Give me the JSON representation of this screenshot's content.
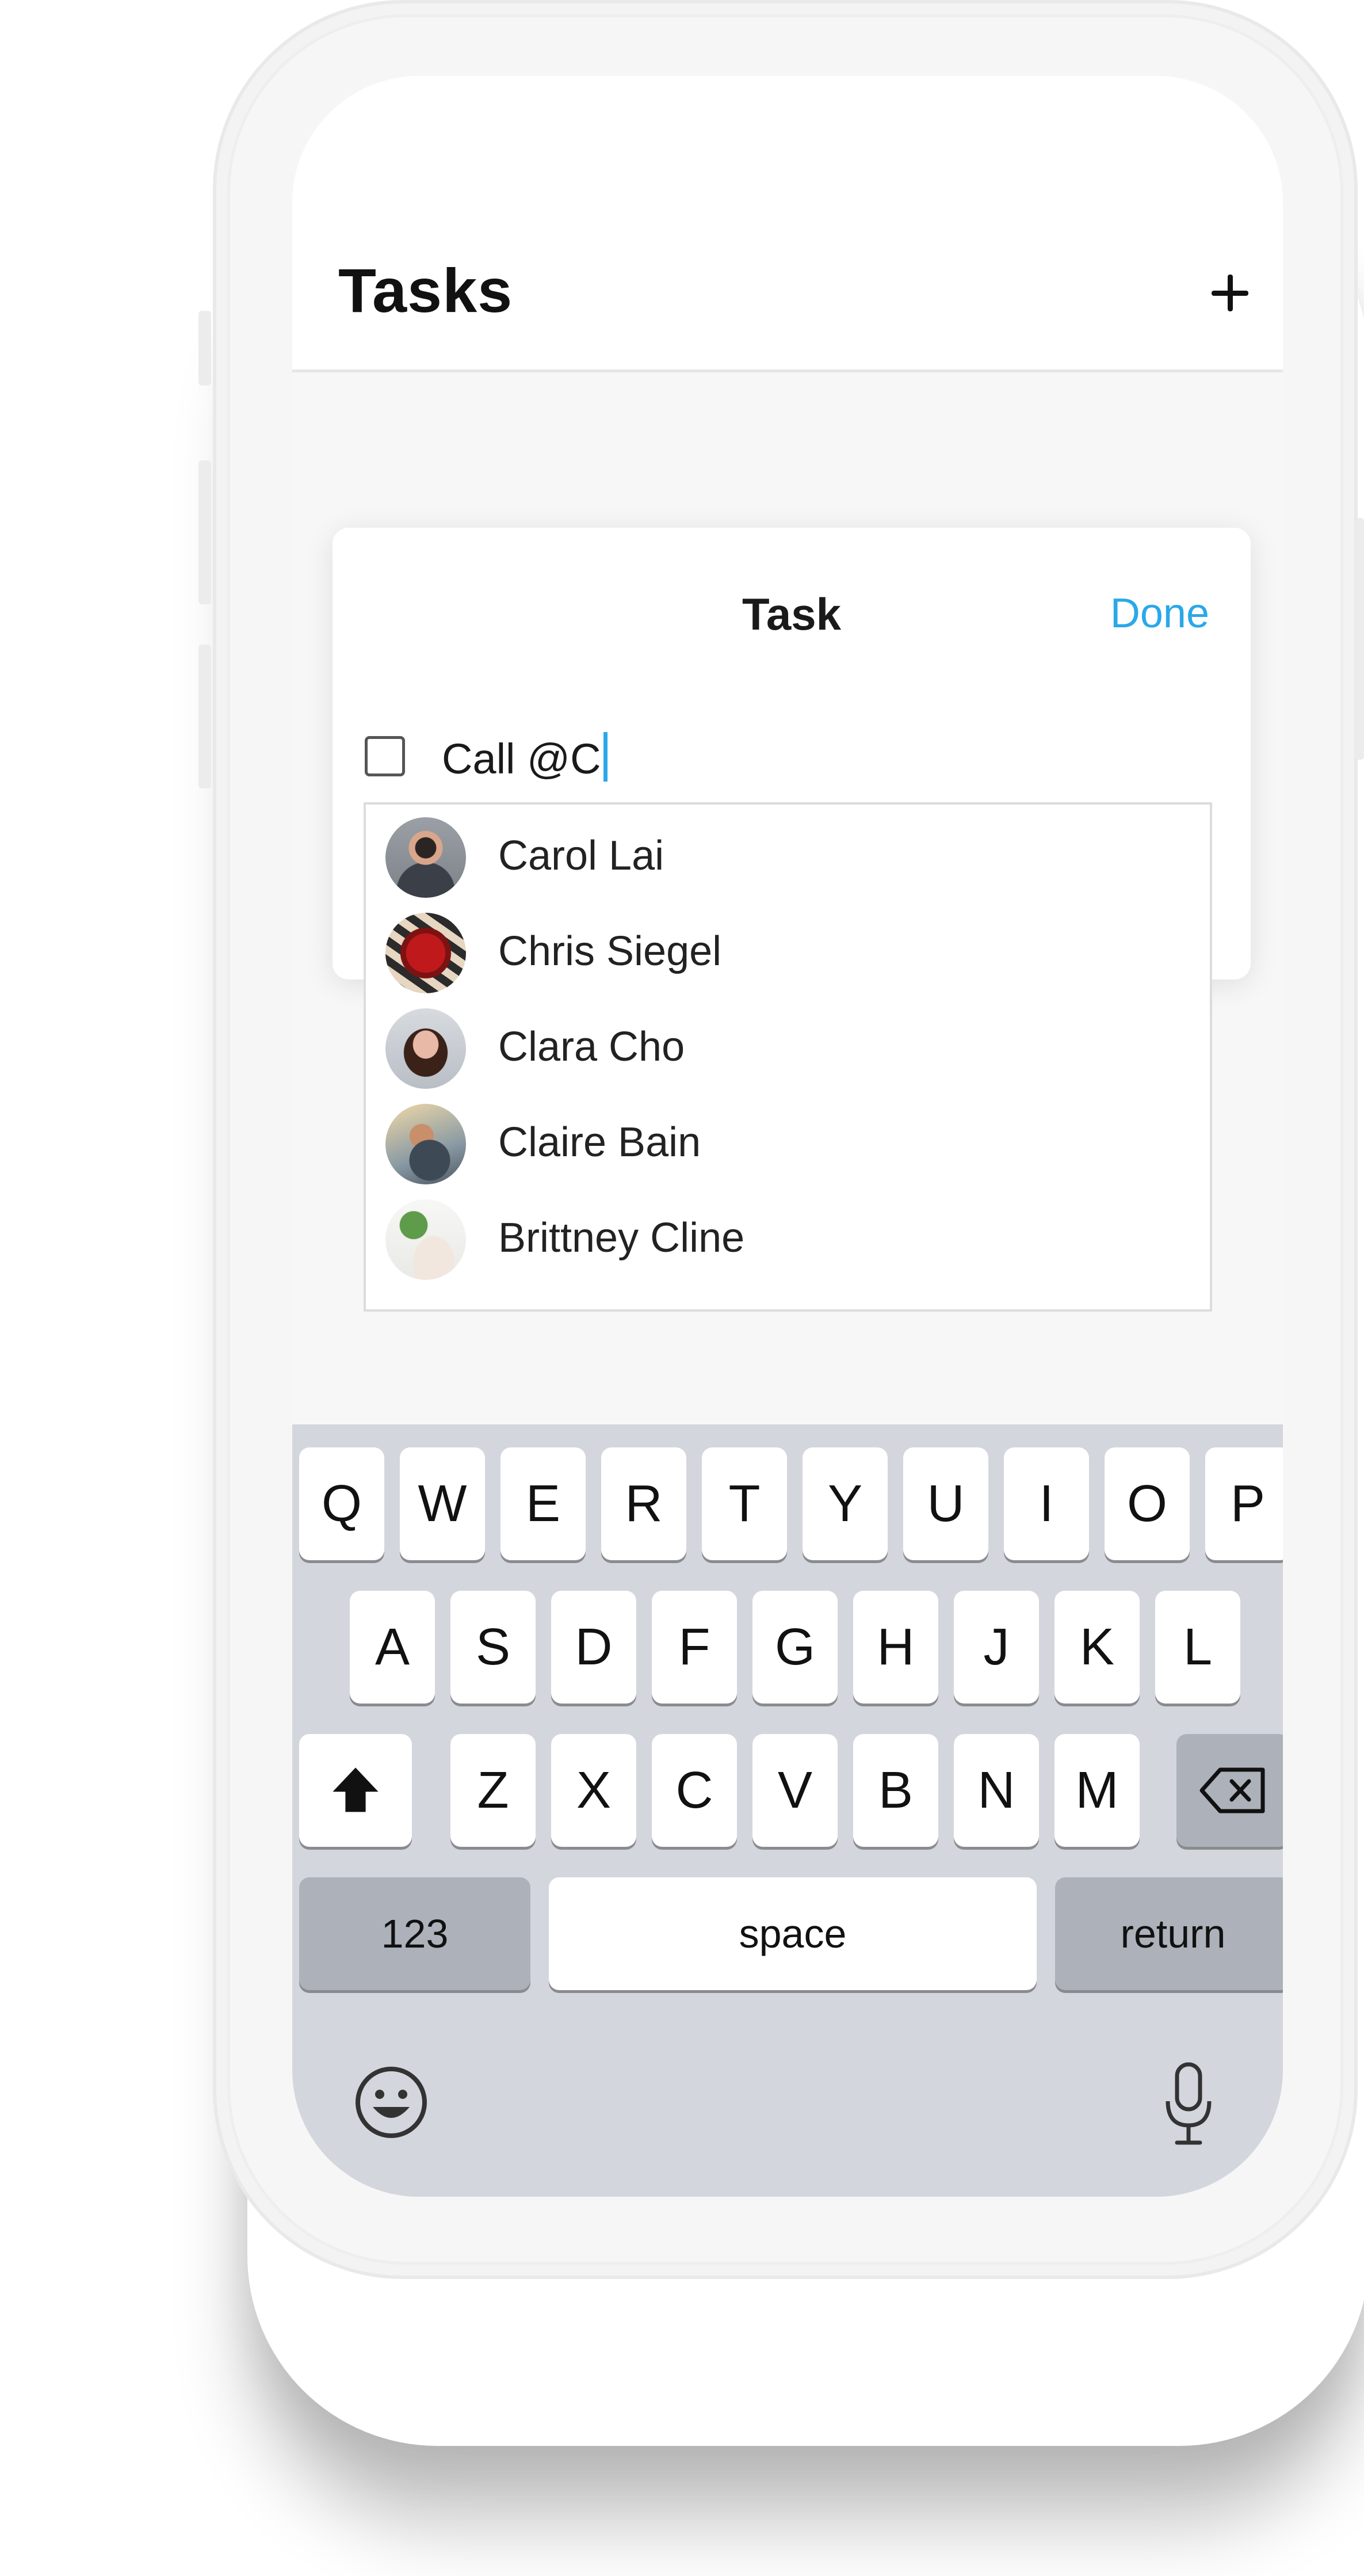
{
  "header": {
    "title": "Tasks",
    "add_icon": "plus-icon"
  },
  "task_sheet": {
    "title": "Task",
    "done_label": "Done",
    "input_value": "Call @C",
    "accent": "#2aa8e8"
  },
  "mentions": [
    {
      "name": "Carol Lai"
    },
    {
      "name": "Chris Siegel"
    },
    {
      "name": "Clara Cho"
    },
    {
      "name": "Claire Bain"
    },
    {
      "name": "Brittney Cline"
    }
  ],
  "keyboard": {
    "row1": [
      "Q",
      "W",
      "E",
      "R",
      "T",
      "Y",
      "U",
      "I",
      "O",
      "P"
    ],
    "row2": [
      "A",
      "S",
      "D",
      "F",
      "G",
      "H",
      "J",
      "K",
      "L"
    ],
    "row3": [
      "Z",
      "X",
      "C",
      "V",
      "B",
      "N",
      "M"
    ],
    "numbers_label": "123",
    "space_label": "space",
    "return_label": "return",
    "shift_icon": "shift-arrow-icon",
    "delete_icon": "backspace-icon",
    "emoji_icon": "emoji-icon",
    "mic_icon": "microphone-icon"
  }
}
